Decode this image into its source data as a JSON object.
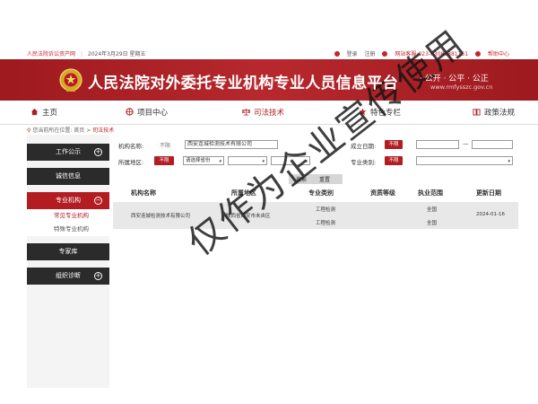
{
  "topbar": {
    "site_name": "人民法院诉讼资产网",
    "date": "2024年3月29日 星期五",
    "login": "登录",
    "register": "注册",
    "hotline": "网站客服:023-63088881161",
    "help": "帮助中心"
  },
  "banner": {
    "title": "人民法院对外委托专业机构专业人员信息平台",
    "slogan": "· 公开 · 公平 · 公正",
    "url": "www.rmfysszc.gov.cn"
  },
  "nav": {
    "items": [
      {
        "label": "主页",
        "icon": "home-icon"
      },
      {
        "label": "项目中心",
        "icon": "globe-icon"
      },
      {
        "label": "司法技术",
        "icon": "scales-icon"
      },
      {
        "label": "特色专栏",
        "icon": "star-icon"
      },
      {
        "label": "政策法规",
        "icon": "book-icon"
      }
    ]
  },
  "breadcrumb": {
    "prefix": "您当前所在位置:",
    "home": "首页",
    "sep": ">",
    "current": "司法技术"
  },
  "sidebar": {
    "sections": [
      {
        "label": "工作公示",
        "toggle": "+"
      },
      {
        "label": "诚信信息"
      },
      {
        "label": "专业机构",
        "toggle": "−",
        "subs": [
          "常见专业机构",
          "特殊专业机构"
        ]
      },
      {
        "label": "专家库"
      },
      {
        "label": "组织诊断",
        "toggle": "+"
      }
    ]
  },
  "filters": {
    "org_name_label": "机构名称:",
    "unlimited": "不限",
    "org_name_value": "西安连城检测技术有限公司",
    "est_date_label": "成立日期:",
    "unlimited_btn": "不限",
    "region_label": "所属地区:",
    "region_select": "请选择省份",
    "category_label": "专业类别:",
    "search": "搜索",
    "reset": "重置"
  },
  "table": {
    "headers": [
      "机构名称",
      "所属地区",
      "专业类别",
      "资质等级",
      "执业范围",
      "更新日期"
    ],
    "rows": [
      {
        "name": "西安连城检测技术有限公司",
        "region": "陕西省西安市未央区",
        "categories": [
          "工程检测",
          "工程检测"
        ],
        "level": "",
        "scope": [
          "全国",
          "全国"
        ],
        "date": "2024-01-16"
      }
    ]
  },
  "watermark": "仅作为企业宣传使用",
  "colors": {
    "brand_red": "#b31d22",
    "dark": "#2b2b2b"
  }
}
